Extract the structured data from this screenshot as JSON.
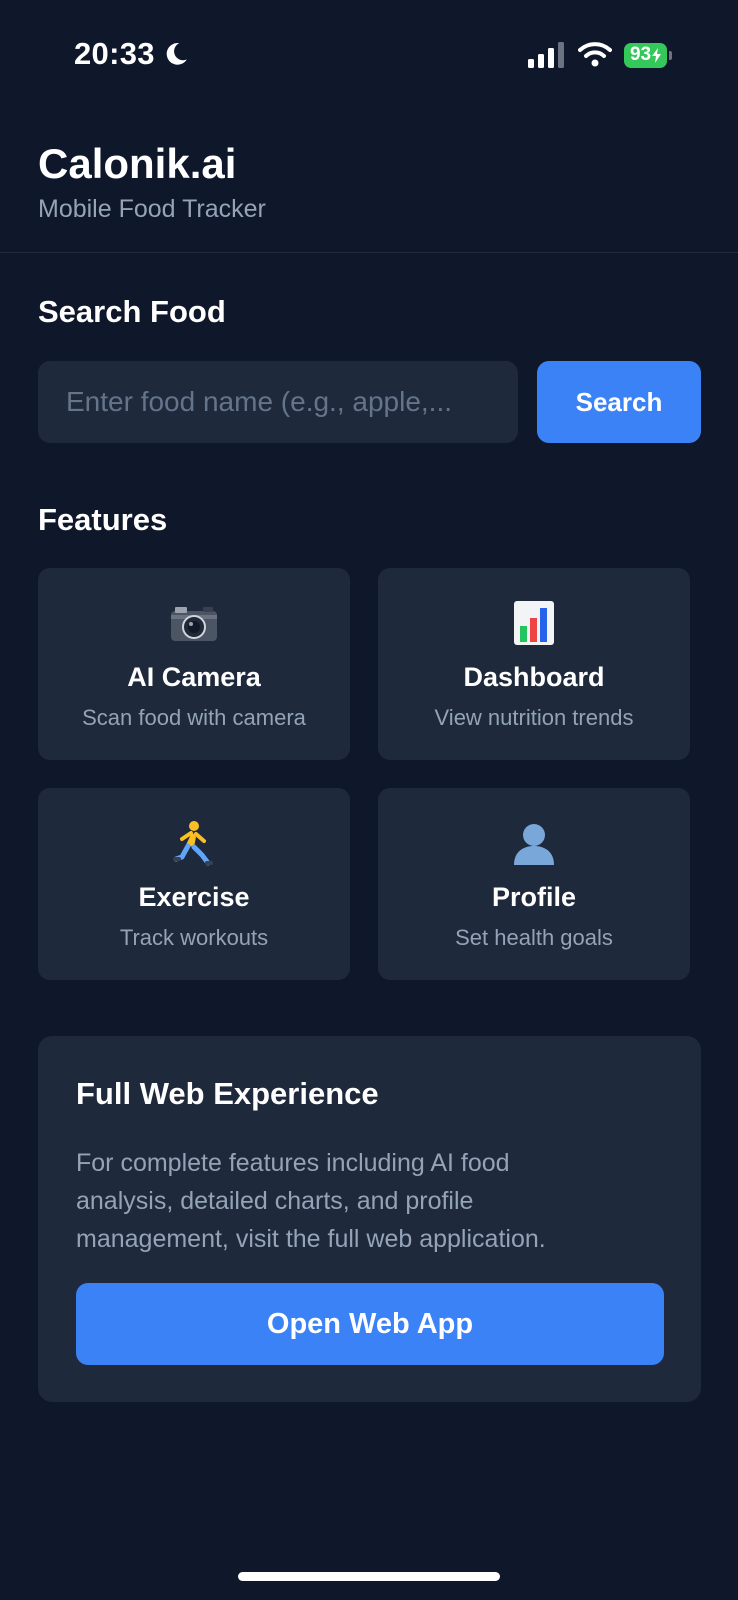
{
  "status_bar": {
    "time": "20:33",
    "battery": "93",
    "icons": [
      "moon-icon",
      "signal-icon",
      "wifi-icon",
      "battery-icon"
    ]
  },
  "header": {
    "title": "Calonik.ai",
    "subtitle": "Mobile Food Tracker"
  },
  "search": {
    "title": "Search Food",
    "placeholder": "Enter food name (e.g., apple,...",
    "button_label": "Search"
  },
  "features": {
    "title": "Features",
    "items": [
      {
        "icon": "camera-icon",
        "title": "AI Camera",
        "description": "Scan food with camera"
      },
      {
        "icon": "bar-chart-icon",
        "title": "Dashboard",
        "description": "View nutrition trends"
      },
      {
        "icon": "runner-icon",
        "title": "Exercise",
        "description": "Track workouts"
      },
      {
        "icon": "user-silhouette-icon",
        "title": "Profile",
        "description": "Set health goals"
      }
    ]
  },
  "web_experience": {
    "title": "Full Web Experience",
    "line1": "For complete features including AI food",
    "line2": "analysis, detailed charts, and profile",
    "line3": "management, visit the full web application.",
    "button_label": "Open Web App"
  },
  "colors": {
    "background": "#0f172a",
    "card": "#1e293b",
    "accent": "#3b82f6",
    "muted_text": "#94a3b8",
    "battery": "#34c759"
  }
}
